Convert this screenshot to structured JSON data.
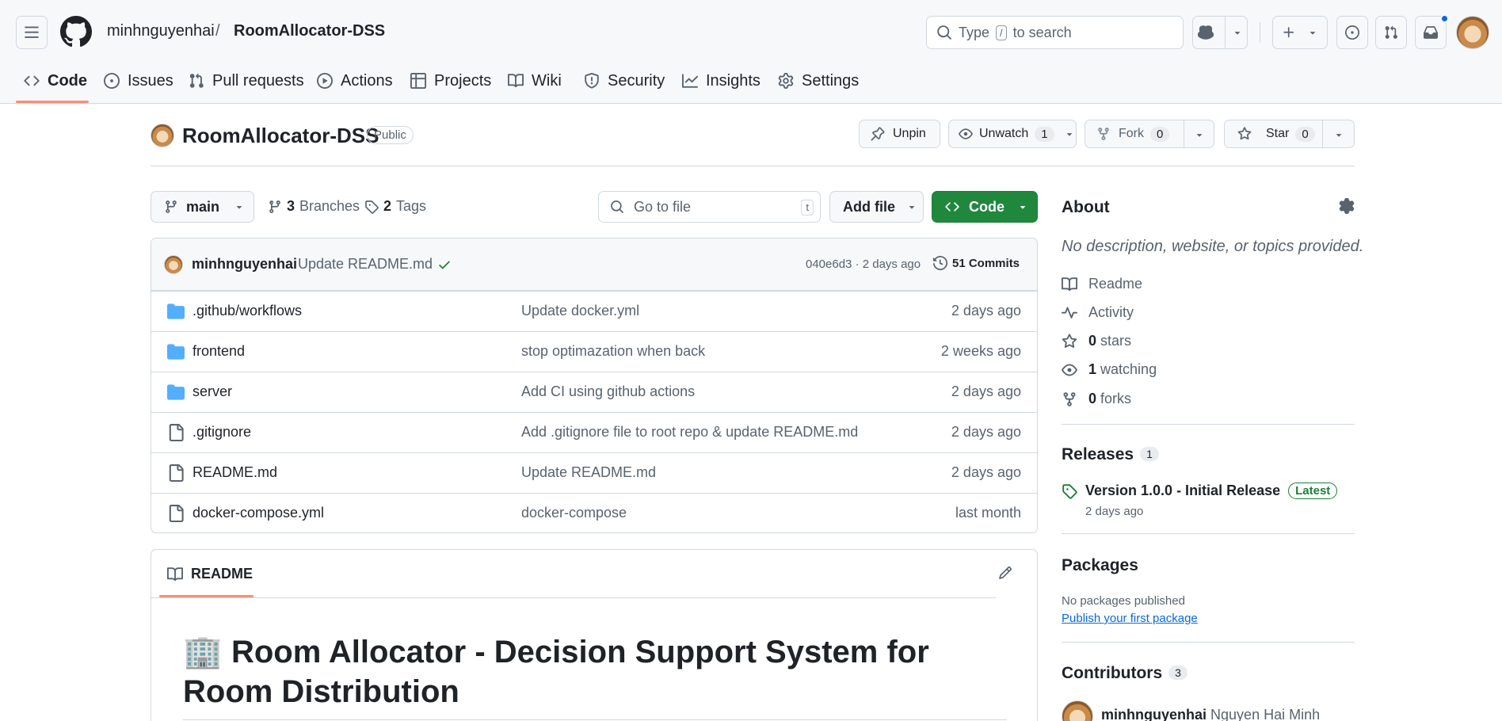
{
  "header": {
    "owner": "minhnguyenhai",
    "separator": "/",
    "repo": "RoomAllocator-DSS",
    "search": {
      "prefix": "Type",
      "key": "/",
      "suffix": "to search"
    }
  },
  "tabs": [
    {
      "label": "Code",
      "icon": "code-icon",
      "active": true
    },
    {
      "label": "Issues",
      "icon": "issue-icon"
    },
    {
      "label": "Pull requests",
      "icon": "pull-request-icon"
    },
    {
      "label": "Actions",
      "icon": "play-icon"
    },
    {
      "label": "Projects",
      "icon": "table-icon"
    },
    {
      "label": "Wiki",
      "icon": "book-icon"
    },
    {
      "label": "Security",
      "icon": "shield-icon"
    },
    {
      "label": "Insights",
      "icon": "graph-icon"
    },
    {
      "label": "Settings",
      "icon": "gear-icon"
    }
  ],
  "title": {
    "repo_name": "RoomAllocator-DSS",
    "visibility": "Public",
    "unpin": "Unpin",
    "unwatch": "Unwatch",
    "watch_count": "1",
    "fork": "Fork",
    "fork_count": "0",
    "star": "Star",
    "star_count": "0"
  },
  "toolbar": {
    "branch": "main",
    "branches_count": "3",
    "branches_label": "Branches",
    "tags_count": "2",
    "tags_label": "Tags",
    "goto_placeholder": "Go to file",
    "goto_key": "t",
    "add_file": "Add file",
    "code": "Code"
  },
  "commit": {
    "author": "minhnguyenhai",
    "message": "Update README.md",
    "hash_date": "040e6d3 · 2 days ago",
    "commits": "51 Commits"
  },
  "files": [
    {
      "name": ".github/workflows",
      "type": "folder",
      "message": "Update docker.yml",
      "date": "2 days ago"
    },
    {
      "name": "frontend",
      "type": "folder",
      "message": "stop optimazation when back",
      "date": "2 weeks ago"
    },
    {
      "name": "server",
      "type": "folder",
      "message": "Add CI using github actions",
      "date": "2 days ago"
    },
    {
      "name": ".gitignore",
      "type": "file",
      "message": "Add .gitignore file to root repo & update README.md",
      "date": "2 days ago"
    },
    {
      "name": "README.md",
      "type": "file",
      "message": "Update README.md",
      "date": "2 days ago"
    },
    {
      "name": "docker-compose.yml",
      "type": "file",
      "message": "docker-compose",
      "date": "last month"
    }
  ],
  "readme": {
    "tab": "README",
    "heading_emoji": "🏢",
    "heading": "Room Allocator - Decision Support System for Room Distribution"
  },
  "about": {
    "title": "About",
    "description": "No description, website, or topics provided.",
    "items": [
      {
        "icon": "book-icon",
        "label": "Readme"
      },
      {
        "icon": "pulse-icon",
        "label": "Activity"
      },
      {
        "icon": "star-icon",
        "count": "0",
        "label": "stars"
      },
      {
        "icon": "eye-icon",
        "count": "1",
        "label": "watching"
      },
      {
        "icon": "fork-icon",
        "count": "0",
        "label": "forks"
      }
    ]
  },
  "releases": {
    "title": "Releases",
    "count": "1",
    "name": "Version 1.0.0 - Initial Release",
    "badge": "Latest",
    "date": "2 days ago"
  },
  "packages": {
    "title": "Packages",
    "none": "No packages published",
    "link": "Publish your first package"
  },
  "contributors": {
    "title": "Contributors",
    "count": "3",
    "first_login": "minhnguyenhai",
    "first_name": "Nguyen Hai Minh"
  },
  "colors": {
    "accent_green": "#1f883d",
    "link_blue": "#0969da",
    "active_tab": "#fd8c73",
    "folder": "#54aeff",
    "notification": "#0969da"
  }
}
